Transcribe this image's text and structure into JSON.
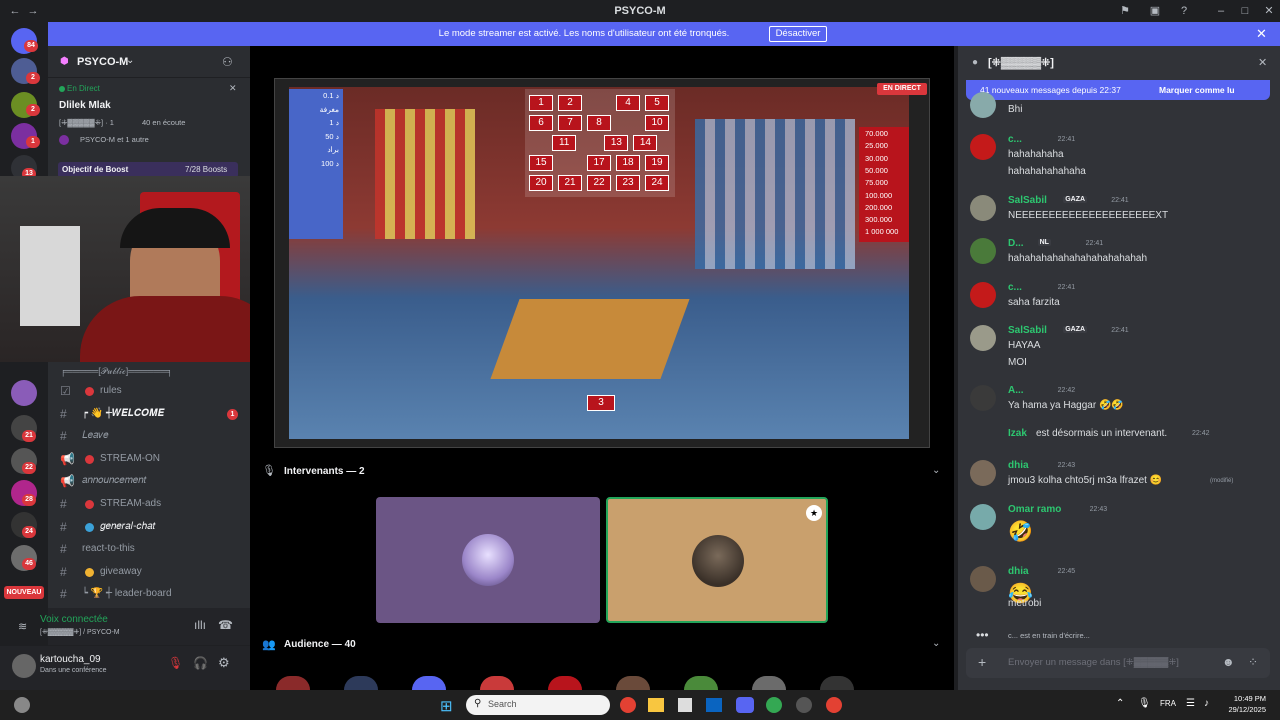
{
  "window": {
    "title": "PSYCO-M"
  },
  "banner": {
    "message": "Le mode streamer est activé. Les noms d'utilisateur ont été tronqués.",
    "button": "Désactiver"
  },
  "rail": {
    "badges": [
      "84",
      "2",
      "2",
      "1",
      "13",
      "21",
      "22",
      "28",
      "24",
      "46"
    ],
    "new_label": "NOUVEAU"
  },
  "server": {
    "name": "PSYCO-M",
    "live_label": "En Direct",
    "stage_title": "Dlilek Mlak",
    "stage_channel": "[⁜▓▓▓▓▓⁜] · 1",
    "listening": "40 en écoute",
    "participants": "PSYCO-M et 1 autre",
    "boost_label": "Objectif de Boost",
    "boost_count": "7/28 Boosts"
  },
  "channels": {
    "category": "╒═════[𝒫𝓊𝒷𝓁𝒾𝒸]══════╕",
    "items": [
      {
        "icon": "rules",
        "label": "rules",
        "color": "#da373c"
      },
      {
        "icon": "hash",
        "label": "┍ 👋 ┽𝑾𝑬𝑳𝑪𝑶𝑴𝑬",
        "badge": "1"
      },
      {
        "icon": "hash",
        "label": "𝐿𝑒𝑎𝑣𝑒"
      },
      {
        "icon": "announce",
        "label": "STREAM-ON",
        "color": "#da373c"
      },
      {
        "icon": "announce",
        "label": "𝑎𝑛𝑛𝑜𝑢𝑛𝑐𝑒𝑚𝑒𝑛𝑡"
      },
      {
        "icon": "hash",
        "label": "STREAM-ads",
        "color": "#da373c"
      },
      {
        "icon": "hash",
        "label": "𝑔𝑒𝑛𝑒𝑟𝑎𝑙-𝑐ℎ𝑎𝑡",
        "color": "#3ba1d8"
      },
      {
        "icon": "hash",
        "label": "react-to-this"
      },
      {
        "icon": "hash",
        "label": "giveaway",
        "color": "#f0b232"
      },
      {
        "icon": "hash",
        "label": "┕ 🏆 ┽ leader-board"
      }
    ]
  },
  "voice": {
    "status": "Voix connectée",
    "channel": "[⁜▓▓▓▓▓⁜] / PSYCO-M"
  },
  "user": {
    "name": "kartoucha_09",
    "status": "Dans une conférence"
  },
  "stage": {
    "live_badge": "EN DIRECT",
    "board_numbers": [
      "1",
      "2",
      "4",
      "5",
      "6",
      "7",
      "8",
      "10",
      "11",
      "13",
      "14",
      "15",
      "17",
      "18",
      "19",
      "20",
      "21",
      "22",
      "23",
      "24"
    ],
    "box_number": "3",
    "left_prizes": [
      "0.1 د",
      "مغرفة",
      "1 د",
      "50 د",
      "براد",
      "100 د"
    ],
    "right_prizes": [
      "70.000",
      "25.000",
      "30.000",
      "50.000",
      "75.000",
      "100.000",
      "200.000",
      "300.000",
      "1 000 000"
    ],
    "speakers_label": "Intervenants — 2",
    "audience_label": "Audience — 40"
  },
  "chat": {
    "header": "[⁜▓▓▓▓▓⁜]",
    "new_messages": "41 nouveaux messages depuis 22:37",
    "mark_read": "Marquer comme lu",
    "messages": [
      {
        "user": "",
        "time": "",
        "lines": [
          "Bhi"
        ],
        "color": "#dbdee1"
      },
      {
        "user": "c...",
        "time": "22:41",
        "lines": [
          "hahahahaha",
          "hahahahahahaha"
        ],
        "color": "#2dc770"
      },
      {
        "user": "SalSabil",
        "tag": "GAZA",
        "time": "22:41",
        "lines": [
          "NEEEEEEEEEEEEEEEEEEEEEXT"
        ],
        "color": "#2dc770"
      },
      {
        "user": "D...",
        "tag": "NL",
        "time": "22:41",
        "lines": [
          "hahahahahahahahahahahahah"
        ],
        "color": "#2dc770"
      },
      {
        "user": "c...",
        "time": "22:41",
        "lines": [
          "saha farzita"
        ],
        "color": "#2dc770"
      },
      {
        "user": "SalSabil",
        "tag": "GAZA",
        "time": "22:41",
        "lines": [
          "HAYAA",
          "MOI"
        ],
        "color": "#2dc770"
      },
      {
        "user": "A...",
        "time": "22:42",
        "lines": [
          "Ya hama ya Haggar 🤣🤣"
        ],
        "color": "#2dc770"
      },
      {
        "user": "Izak",
        "time": "22:42",
        "lines": [
          "est désormais un intervenant."
        ],
        "color": "#2dc770"
      },
      {
        "user": "dhia",
        "time": "22:43",
        "lines": [
          "jmou3 kolha chto5rj m3a lfrazet 😊"
        ],
        "edited": "(modifié)",
        "color": "#2dc770"
      },
      {
        "user": "Omar ramo",
        "time": "22:43",
        "lines": [
          "🤣"
        ],
        "color": "#2dc770"
      },
      {
        "user": "dhia",
        "time": "22:45",
        "lines": [
          "😂",
          "metrobi"
        ],
        "color": "#2dc770"
      }
    ],
    "typing": "c... est en train d'écrire...",
    "input_placeholder": "Envoyer un message dans [⁜▓▓▓▓▓⁜]"
  },
  "taskbar": {
    "search_placeholder": "Search",
    "lang": "FRA",
    "time": "10:49 PM",
    "date": "29/12/2025"
  }
}
